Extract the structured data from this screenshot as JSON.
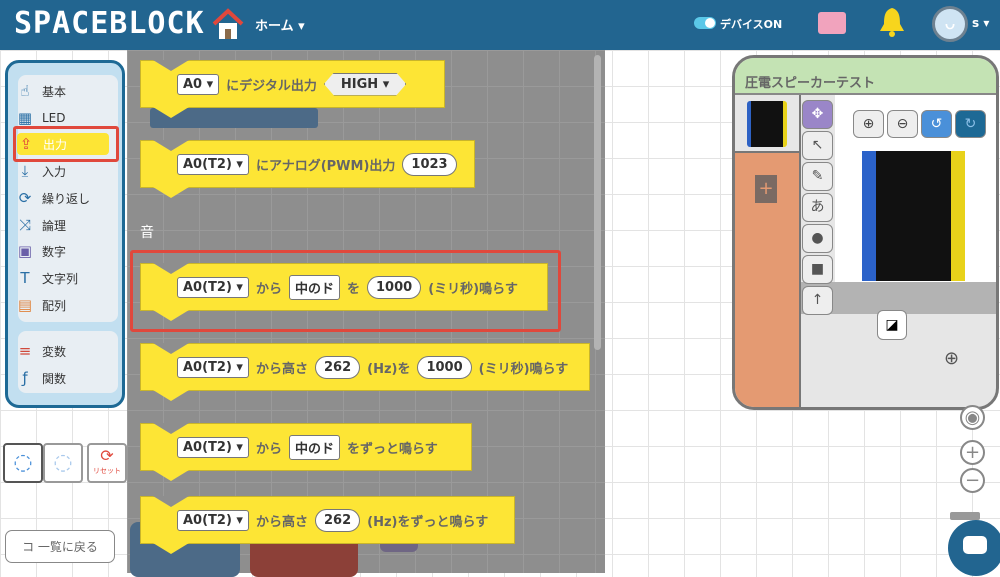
{
  "header": {
    "logo": "SPACEBLOCK",
    "home_label": "ホーム ▾",
    "device_label": "デバイスON",
    "user_label": "s ▾"
  },
  "colors": {
    "header": "#226590",
    "block": "#fde535",
    "highlight": "#e0483c",
    "panel_header": "#c4e3b4",
    "panel_side": "#e49a72"
  },
  "toolbox": {
    "items": [
      {
        "label": "基本",
        "icon": "hand-pointer-icon"
      },
      {
        "label": "LED",
        "icon": "led-matrix-icon"
      },
      {
        "label": "出力",
        "icon": "upload-output-icon",
        "selected": true
      },
      {
        "label": "入力",
        "icon": "download-input-icon"
      },
      {
        "label": "繰り返し",
        "icon": "loop-icon"
      },
      {
        "label": "論理",
        "icon": "shuffle-logic-icon"
      },
      {
        "label": "数字",
        "icon": "number-icon"
      },
      {
        "label": "文字列",
        "icon": "text-t-icon"
      },
      {
        "label": "配列",
        "icon": "array-icon"
      }
    ],
    "extra": [
      {
        "label": "変数",
        "icon": "variable-icon"
      },
      {
        "label": "関数",
        "icon": "function-icon"
      }
    ]
  },
  "blocks": {
    "b1": {
      "pin": "A0 ▾",
      "text": "にデジタル出力",
      "value": "HIGH ▾"
    },
    "b2": {
      "pin": "A0(T2) ▾",
      "text": "にアナログ(PWM)出力",
      "value": "1023"
    },
    "section": "音",
    "b3": {
      "pin": "A0(T2) ▾",
      "t1": "から",
      "note": "中のド",
      "t2": "を",
      "ms": "1000",
      "t3": "(ミリ秒)鳴らす"
    },
    "b4": {
      "pin": "A0(T2) ▾",
      "t1": "から高さ",
      "hz": "262",
      "t2": "(Hz)を",
      "ms": "1000",
      "t3": "(ミリ秒)鳴らす"
    },
    "b5": {
      "pin": "A0(T2) ▾",
      "t1": "から",
      "note": "中のド",
      "t2": "をずっと鳴らす"
    },
    "b6": {
      "pin": "A0(T2) ▾",
      "t1": "から高さ",
      "hz": "262",
      "t2": "(Hz)をずっと鳴らす"
    }
  },
  "controls": {
    "reset_label": "リセット",
    "back_label": "コ 一覧に戻る"
  },
  "panel": {
    "title": "圧電スピーカーテスト",
    "tools": [
      "move",
      "pointer",
      "pen",
      "あ",
      "circle",
      "square",
      "up"
    ]
  }
}
